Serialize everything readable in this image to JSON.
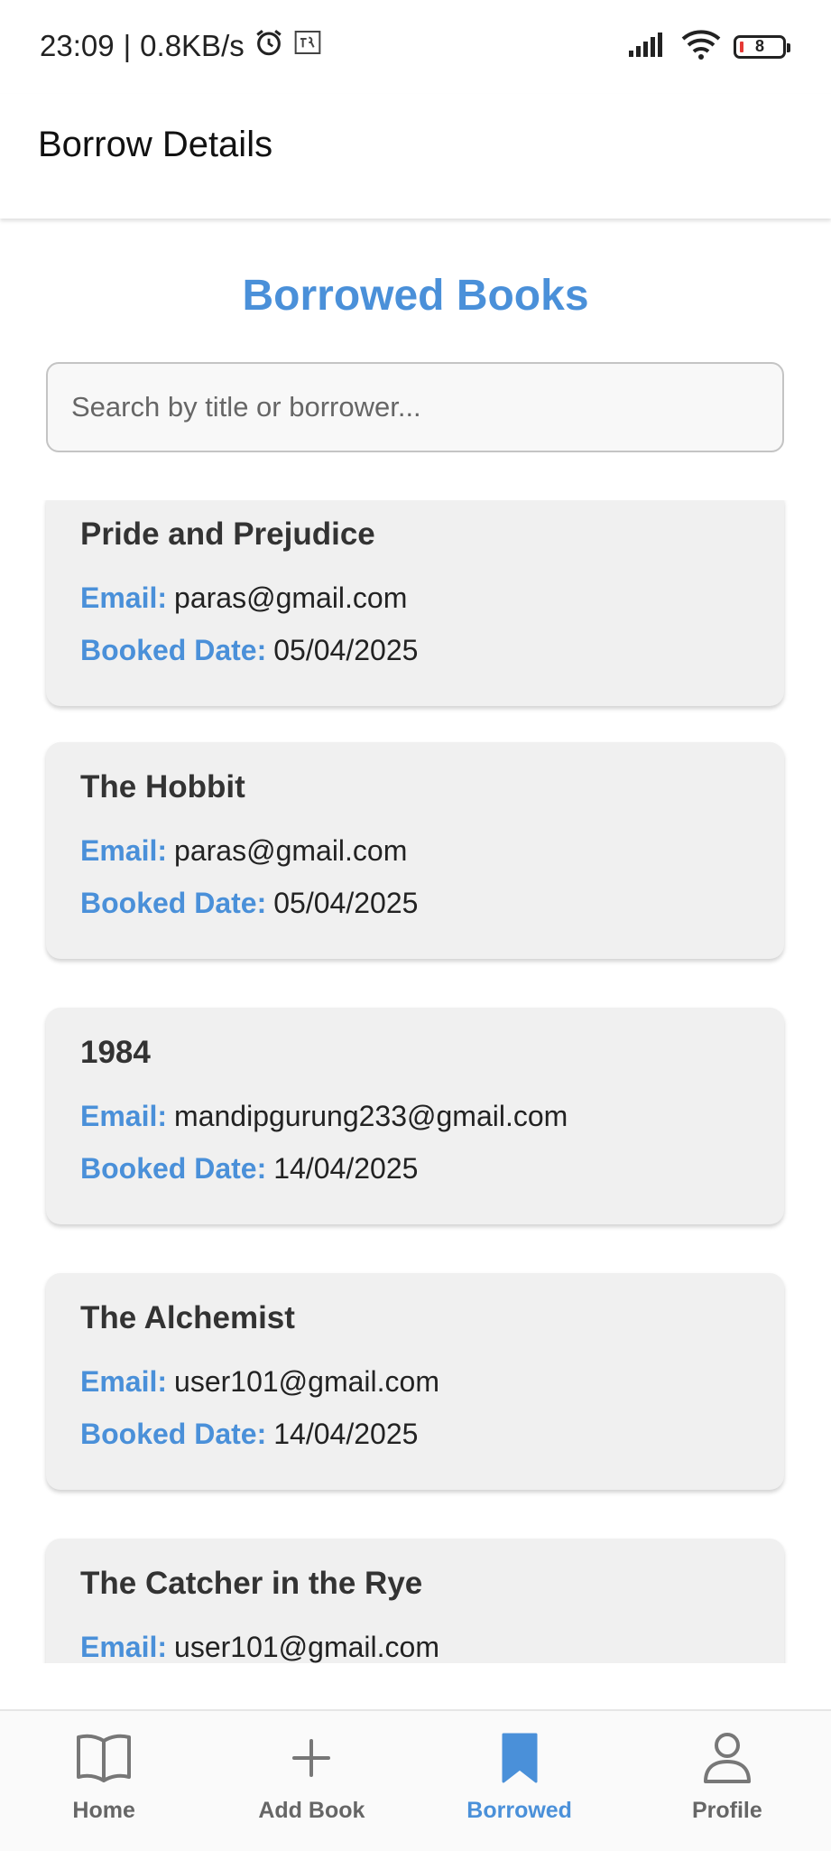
{
  "status_bar": {
    "time": "23:09",
    "speed": "0.8KB/s",
    "battery": "8"
  },
  "header": {
    "title": "Borrow Details"
  },
  "main": {
    "title": "Borrowed Books",
    "search": {
      "placeholder": "Search by title or borrower...",
      "value": ""
    },
    "email_label": "Email:",
    "date_label": "Booked Date:",
    "books": [
      {
        "title": "Pride and Prejudice",
        "email": "paras@gmail.com",
        "date": "05/04/2025"
      },
      {
        "title": "The Hobbit",
        "email": "paras@gmail.com",
        "date": "05/04/2025"
      },
      {
        "title": "1984",
        "email": "mandipgurung233@gmail.com",
        "date": "14/04/2025"
      },
      {
        "title": "The Alchemist",
        "email": "user101@gmail.com",
        "date": "14/04/2025"
      },
      {
        "title": "The Catcher in the Rye",
        "email": "user101@gmail.com",
        "date": ""
      }
    ]
  },
  "nav": {
    "items": [
      {
        "label": "Home",
        "icon": "book-open-icon"
      },
      {
        "label": "Add Book",
        "icon": "plus-icon"
      },
      {
        "label": "Borrowed",
        "icon": "bookmark-icon",
        "active": true
      },
      {
        "label": "Profile",
        "icon": "user-icon"
      }
    ]
  },
  "colors": {
    "accent": "#4a90d9",
    "card": "#f0f0f0",
    "text": "#333333",
    "inactive": "#666666"
  }
}
